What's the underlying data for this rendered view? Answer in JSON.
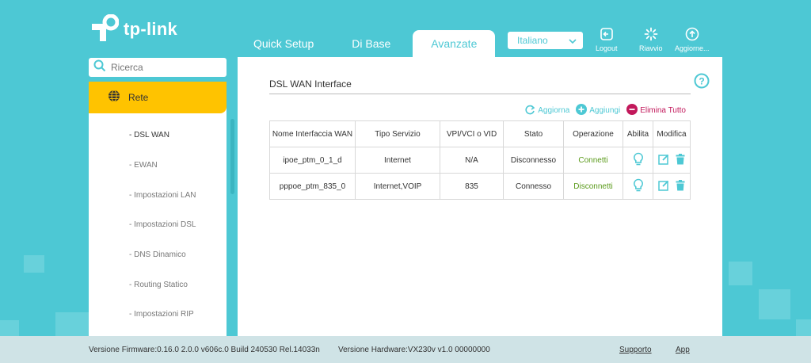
{
  "brand": {
    "logo_text": "tp-link"
  },
  "tabs": [
    {
      "label": "Quick Setup"
    },
    {
      "label": "Di Base"
    },
    {
      "label": "Avanzate"
    }
  ],
  "language": {
    "selected": "Italiano"
  },
  "top_actions": {
    "logout": "Logout",
    "reboot": "Riavvio",
    "update": "Aggiorne..."
  },
  "search": {
    "placeholder": "Ricerca"
  },
  "sidebar": {
    "section": "Rete",
    "items": [
      {
        "label": "- DSL WAN"
      },
      {
        "label": "- EWAN"
      },
      {
        "label": "- Impostazioni LAN"
      },
      {
        "label": "- Impostazioni DSL"
      },
      {
        "label": "- DNS Dinamico"
      },
      {
        "label": "- Routing Statico"
      },
      {
        "label": "- Impostazioni RIP"
      }
    ]
  },
  "page": {
    "title": "DSL WAN Interface",
    "actions": {
      "refresh": "Aggiorna",
      "add": "Aggiungi",
      "delete_all": "Elimina Tutto"
    }
  },
  "table": {
    "headers": [
      "Nome Interfaccia WAN",
      "Tipo Servizio",
      "VPI/VCI o VID",
      "Stato",
      "Operazione",
      "Abilita",
      "Modifica"
    ],
    "rows": [
      {
        "name": "ipoe_ptm_0_1_d",
        "service": "Internet",
        "vid": "N/A",
        "status": "Disconnesso",
        "operation": "Connetti"
      },
      {
        "name": "pppoe_ptm_835_0",
        "service": "Internet,VOIP",
        "vid": "835",
        "status": "Connesso",
        "operation": "Disconnetti"
      }
    ]
  },
  "footer": {
    "firmware": "Versione Firmware:0.16.0 2.0.0 v606c.0 Build 240530 Rel.14033n",
    "hardware": "Versione Hardware:VX230v v1.0 00000000",
    "support": "Supporto",
    "app": "App"
  },
  "colors": {
    "teal": "#4dc8d4",
    "yellow": "#ffc300",
    "green": "#5a9a1a",
    "magenta": "#c2185b"
  }
}
